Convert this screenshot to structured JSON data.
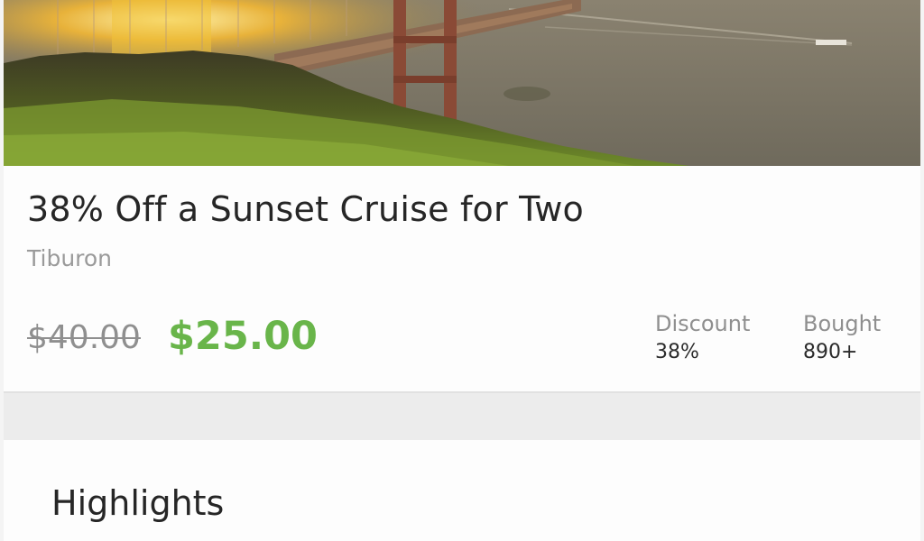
{
  "deal": {
    "title": "38% Off a Sunset Cruise for Two",
    "location": "Tiburon",
    "original_price": "$40.00",
    "price": "$25.00"
  },
  "stats": {
    "discount_label": "Discount",
    "discount_value": "38%",
    "bought_label": "Bought",
    "bought_value": "890+"
  },
  "highlights": {
    "title": "Highlights"
  },
  "colors": {
    "price_green": "#69b54a",
    "title_text": "#262626",
    "muted_text": "#9a9a9a"
  }
}
